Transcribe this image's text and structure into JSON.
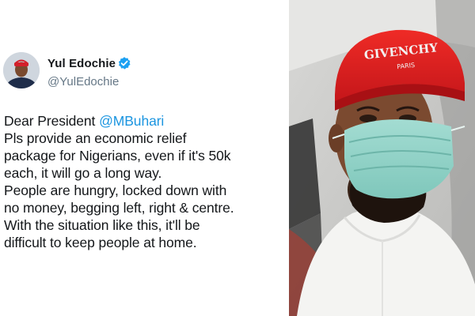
{
  "tweet": {
    "author": {
      "display_name": "Yul Edochie",
      "handle": "@YulEdochie",
      "verified": true
    },
    "greeting": "Dear President",
    "mention": "@MBuhari",
    "lines": [
      "Pls provide an economic relief",
      "package for Nigerians, even if it's 50k",
      "each, it will go a long way.",
      "People are hungry, locked down with",
      "no money, begging left, right & centre.",
      "With the situation like this, it'll be",
      "difficult to keep people at home."
    ]
  },
  "photo": {
    "cap_brand": "GIVENCHY",
    "cap_sub": "PARIS"
  },
  "colors": {
    "mention": "#1b95e0",
    "verified_badge": "#1da1f2",
    "handle_gray": "#657786",
    "cap_red": "#e11f1f",
    "mask_teal": "#8fd3c8"
  }
}
